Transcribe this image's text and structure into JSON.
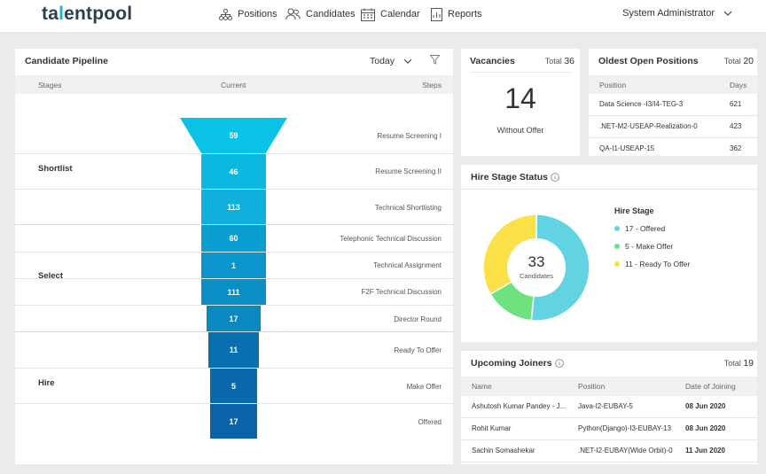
{
  "app": {
    "logo_prefix": "ta",
    "logo_accent": "l",
    "logo_suffix": "entpool",
    "nav": [
      {
        "label": "Positions",
        "icon": "org-chart-icon"
      },
      {
        "label": "Candidates",
        "icon": "people-icon"
      },
      {
        "label": "Calendar",
        "icon": "calendar-icon"
      },
      {
        "label": "Reports",
        "icon": "report-icon"
      }
    ],
    "user": "System Administrator"
  },
  "pipeline": {
    "title": "Candidate Pipeline",
    "period": "Today",
    "columns": {
      "stages": "Stages",
      "current": "Current",
      "steps": "Steps"
    },
    "groups": [
      "Shortlist",
      "Select",
      "Hire"
    ],
    "steps": [
      {
        "label": "Resume Screening I",
        "value": "59",
        "color": "#0ac2e6"
      },
      {
        "label": "Resume Screening II",
        "value": "46",
        "color": "#0ab8e0"
      },
      {
        "label": "Technical Shortlisting",
        "value": "113",
        "color": "#10b0dc"
      },
      {
        "label": "Telephonic Technical Discussion",
        "value": "60",
        "color": "#0a9ed1"
      },
      {
        "label": "Technical Assignment",
        "value": "1",
        "color": "#0a96cc"
      },
      {
        "label": "F2F Technical Discussion",
        "value": "111",
        "color": "#0a8ec6"
      },
      {
        "label": "Director Round",
        "value": "17",
        "color": "#0a88c1"
      },
      {
        "label": "Ready To Offer",
        "value": "11",
        "color": "#0a6fb0"
      },
      {
        "label": "Make Offer",
        "value": "5",
        "color": "#0a69ac"
      },
      {
        "label": "Offered",
        "value": "17",
        "color": "#0a63a8"
      }
    ]
  },
  "vacancies": {
    "title": "Vacancies",
    "total_label": "Total",
    "total": "36",
    "big_number": "14",
    "caption": "Without Offer"
  },
  "oldest": {
    "title": "Oldest Open Positions",
    "total_label": "Total",
    "total": "20",
    "col_position": "Position",
    "col_days": "Days",
    "rows": [
      {
        "position": "Data Science -I3/I4-TEG-3",
        "days": "621"
      },
      {
        "position": ".NET-M2-USEAP-Realization-0",
        "days": "423"
      },
      {
        "position": "QA-I1-USEAP-15",
        "days": "362"
      }
    ]
  },
  "hire_status": {
    "title": "Hire Stage Status",
    "center_value": "33",
    "center_label": "Candidates",
    "legend_title": "Hire Stage",
    "colors": {
      "offered": "#62d3e3",
      "make_offer": "#6de27f",
      "ready": "#fbe048"
    },
    "items": [
      {
        "label": "17 - Offered",
        "value": 17
      },
      {
        "label": "5 - Make Offer",
        "value": 5
      },
      {
        "label": "11 - Ready To Offer",
        "value": 11
      }
    ]
  },
  "joiners": {
    "title": "Upcoming Joiners",
    "total_label": "Total",
    "total": "19",
    "col_name": "Name",
    "col_position": "Position",
    "col_date": "Date of Joining",
    "rows": [
      {
        "name": "Ashutosh Kumar Pandey - J...",
        "position": "Java-I2-EUBAY-5",
        "date": "08 Jun 2020"
      },
      {
        "name": "Rohit Kumar",
        "position": "Python(Django)-I3-EUBAY-13",
        "date": "08 Jun 2020"
      },
      {
        "name": "Sachin Somashekar",
        "position": ".NET-I2-EUBAY(Wide Orbit)-0",
        "date": "11 Jun 2020"
      }
    ]
  }
}
